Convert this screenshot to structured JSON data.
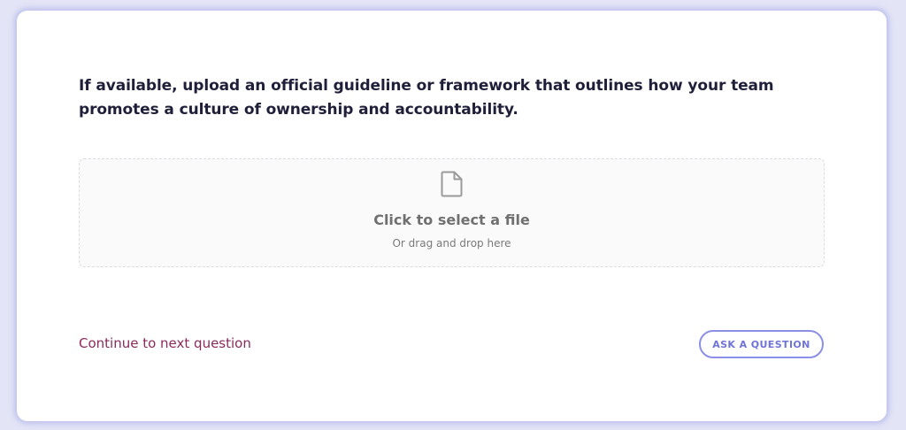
{
  "question": {
    "text": "If available, upload an official guideline or framework that outlines how your team promotes a culture of ownership and accountability."
  },
  "upload": {
    "icon": "file-icon",
    "title": "Click to select a file",
    "subtitle": "Or drag and drop here"
  },
  "actions": {
    "continue_label": "Continue to next question",
    "ask_label": "ASK A QUESTION"
  },
  "colors": {
    "page_background": "#e3e4f6",
    "card_background": "#ffffff",
    "question_text": "#1f1f3a",
    "link": "#8a2a5c",
    "accent": "#8b90e6"
  }
}
